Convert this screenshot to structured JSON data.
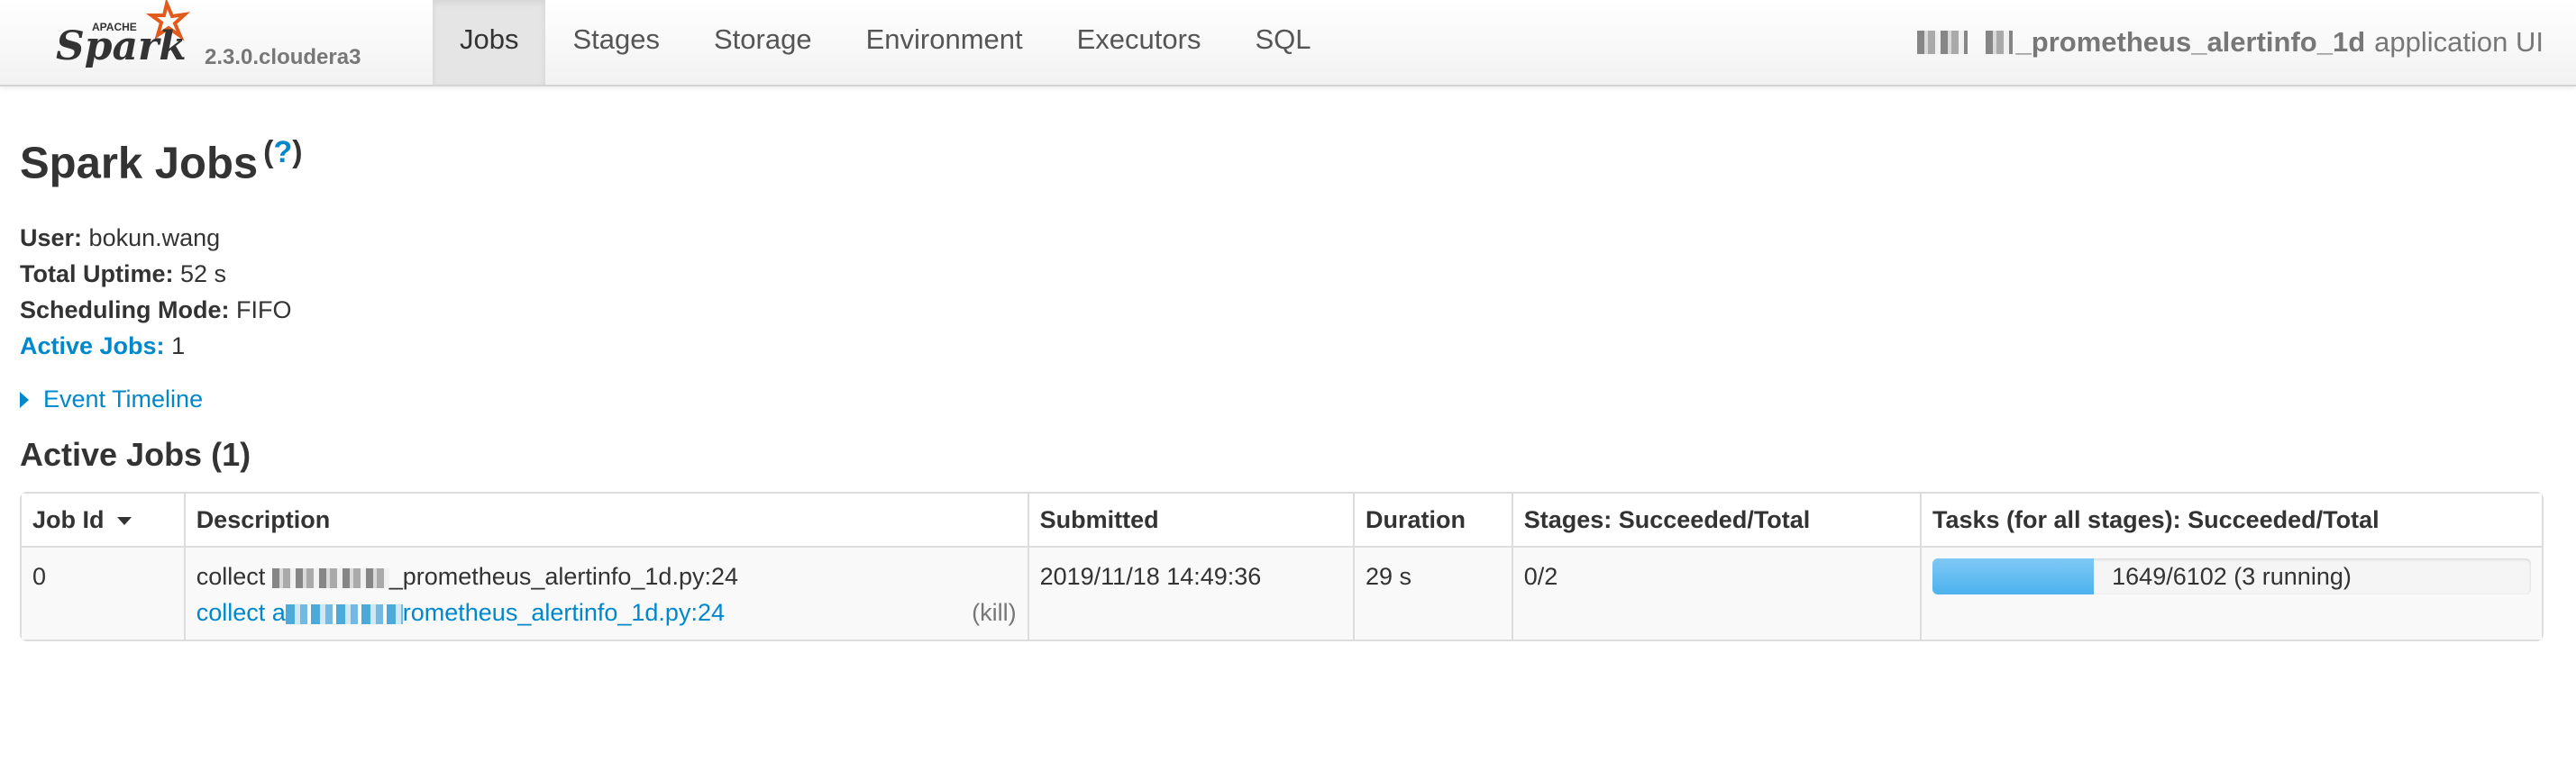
{
  "navbar": {
    "logo_text": "Spark",
    "logo_subtext": "APACHE",
    "version": "2.3.0.cloudera3",
    "tabs": [
      {
        "label": "Jobs",
        "active": true
      },
      {
        "label": "Stages",
        "active": false
      },
      {
        "label": "Storage",
        "active": false
      },
      {
        "label": "Environment",
        "active": false
      },
      {
        "label": "Executors",
        "active": false
      },
      {
        "label": "SQL",
        "active": false
      }
    ],
    "app_name": "_prometheus_alertinfo_1d",
    "app_suffix": "application UI"
  },
  "page": {
    "title": "Spark Jobs",
    "help": "?",
    "summary": {
      "user_label": "User:",
      "user_value": "bokun.wang",
      "uptime_label": "Total Uptime:",
      "uptime_value": "52 s",
      "mode_label": "Scheduling Mode:",
      "mode_value": "FIFO",
      "active_label": "Active Jobs:",
      "active_value": "1"
    },
    "event_timeline": "Event Timeline",
    "active_jobs_heading": "Active Jobs (1)"
  },
  "jobs_table": {
    "headers": [
      "Job Id",
      "Description",
      "Submitted",
      "Duration",
      "Stages: Succeeded/Total",
      "Tasks (for all stages): Succeeded/Total"
    ],
    "rows": [
      {
        "job_id": "0",
        "description_prefix": "collect",
        "description_suffix": "_prometheus_alertinfo_1d.py:24",
        "link_prefix": "collect a",
        "link_suffix": "rometheus_alertinfo_1d.py:24",
        "kill": "(kill)",
        "submitted": "2019/11/18 14:49:36",
        "duration": "29 s",
        "stages": "0/2",
        "tasks_text": "1649/6102 (3 running)",
        "tasks_progress": 0.2702
      }
    ]
  },
  "colors": {
    "link": "#0088cc",
    "progress": "#4db2ee",
    "logo_orange": "#e25a1c"
  }
}
